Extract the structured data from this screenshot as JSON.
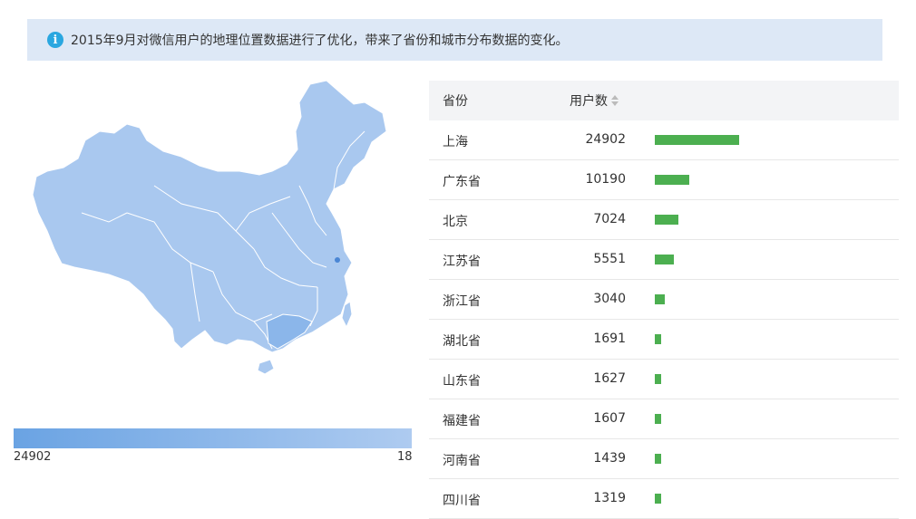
{
  "notice": {
    "icon": "info-icon",
    "text": "2015年9月对微信用户的地理位置数据进行了优化，带来了省份和城市分布数据的变化。"
  },
  "legend": {
    "max_label": "24902",
    "min_label": "18"
  },
  "colors": {
    "bar": "#4caf50",
    "map_base": "#a9c8ef",
    "map_highlight": "#8bb6ea",
    "legend_start": "#6aa3e3",
    "legend_end": "#aecbf0"
  },
  "table": {
    "headers": {
      "province": "省份",
      "users": "用户数"
    },
    "rows": [
      {
        "name": "上海",
        "value": "24902",
        "ratio": 1.0
      },
      {
        "name": "广东省",
        "value": "10190",
        "ratio": 0.409
      },
      {
        "name": "北京",
        "value": "7024",
        "ratio": 0.282
      },
      {
        "name": "江苏省",
        "value": "5551",
        "ratio": 0.223
      },
      {
        "name": "浙江省",
        "value": "3040",
        "ratio": 0.122
      },
      {
        "name": "湖北省",
        "value": "1691",
        "ratio": 0.068
      },
      {
        "name": "山东省",
        "value": "1627",
        "ratio": 0.065
      },
      {
        "name": "福建省",
        "value": "1607",
        "ratio": 0.065
      },
      {
        "name": "河南省",
        "value": "1439",
        "ratio": 0.058
      },
      {
        "name": "四川省",
        "value": "1319",
        "ratio": 0.053
      }
    ]
  }
}
